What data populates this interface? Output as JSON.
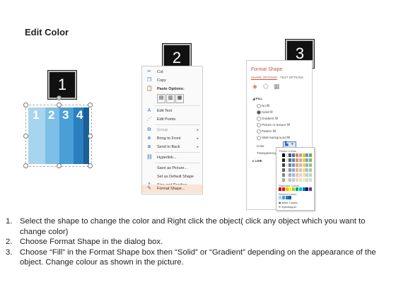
{
  "title": "Edit Color",
  "badges": [
    "1",
    "2",
    "3"
  ],
  "panel1": {
    "digits": [
      "1",
      "2",
      "3",
      "4"
    ],
    "bar_colors": [
      "#a7d4ee",
      "#7dbfe6",
      "#4a9fd6",
      "#2a7fbd",
      "#1a5f97"
    ]
  },
  "context_menu": {
    "items": [
      {
        "icon": "scissors-icon",
        "label": "Cut"
      },
      {
        "icon": "copy-icon",
        "label": "Copy"
      },
      {
        "icon": "paste-icon",
        "label": "Paste Options:"
      },
      {
        "icon": "",
        "label": ""
      },
      {
        "icon": "edit-text-icon",
        "label": "Edit Text"
      },
      {
        "icon": "edit-points-icon",
        "label": "Edit Points"
      },
      {
        "icon": "group-icon",
        "label": "Group"
      },
      {
        "icon": "bring-front-icon",
        "label": "Bring to Front"
      },
      {
        "icon": "send-back-icon",
        "label": "Send to Back"
      },
      {
        "icon": "hyperlink-icon",
        "label": "Hyperlink..."
      },
      {
        "icon": "",
        "label": "Save as Picture..."
      },
      {
        "icon": "",
        "label": "Set as Default Shape"
      },
      {
        "icon": "size-position-icon",
        "label": "Size and Position..."
      },
      {
        "icon": "format-shape-icon",
        "label": "Format Shape..."
      }
    ]
  },
  "format_shape": {
    "title": "Format Shape",
    "tabs": [
      "SHAPE OPTIONS",
      "TEXT OPTIONS"
    ],
    "fill_header": "FILL",
    "fill_options": [
      "No fill",
      "Solid fill",
      "Gradient fill",
      "Picture or texture fill",
      "Pattern fill",
      "Slide background fill"
    ],
    "selected_fill": "Solid fill",
    "color_label": "Color",
    "transparency_label": "Transparency",
    "line_header": "LINE",
    "palette": {
      "theme_colors": "Theme Colors",
      "standard_colors": "Standard Colors",
      "recent_colors": "Recent Colors",
      "more_colors": "More Colors...",
      "eyedropper": "Eyedropper"
    }
  },
  "instructions": [
    {
      "num": "1.",
      "text": "Select the shape to change the color and Right click the object( click any object which you want to change color)"
    },
    {
      "num": "2.",
      "text": "Choose Format Shape in the dialog box."
    },
    {
      "num": "3.",
      "text": "Choose “Fill” in the Format Shape box then “Solid” or “Gradient” depending on the appearance of the object. Change colour as shown in the picture."
    }
  ]
}
